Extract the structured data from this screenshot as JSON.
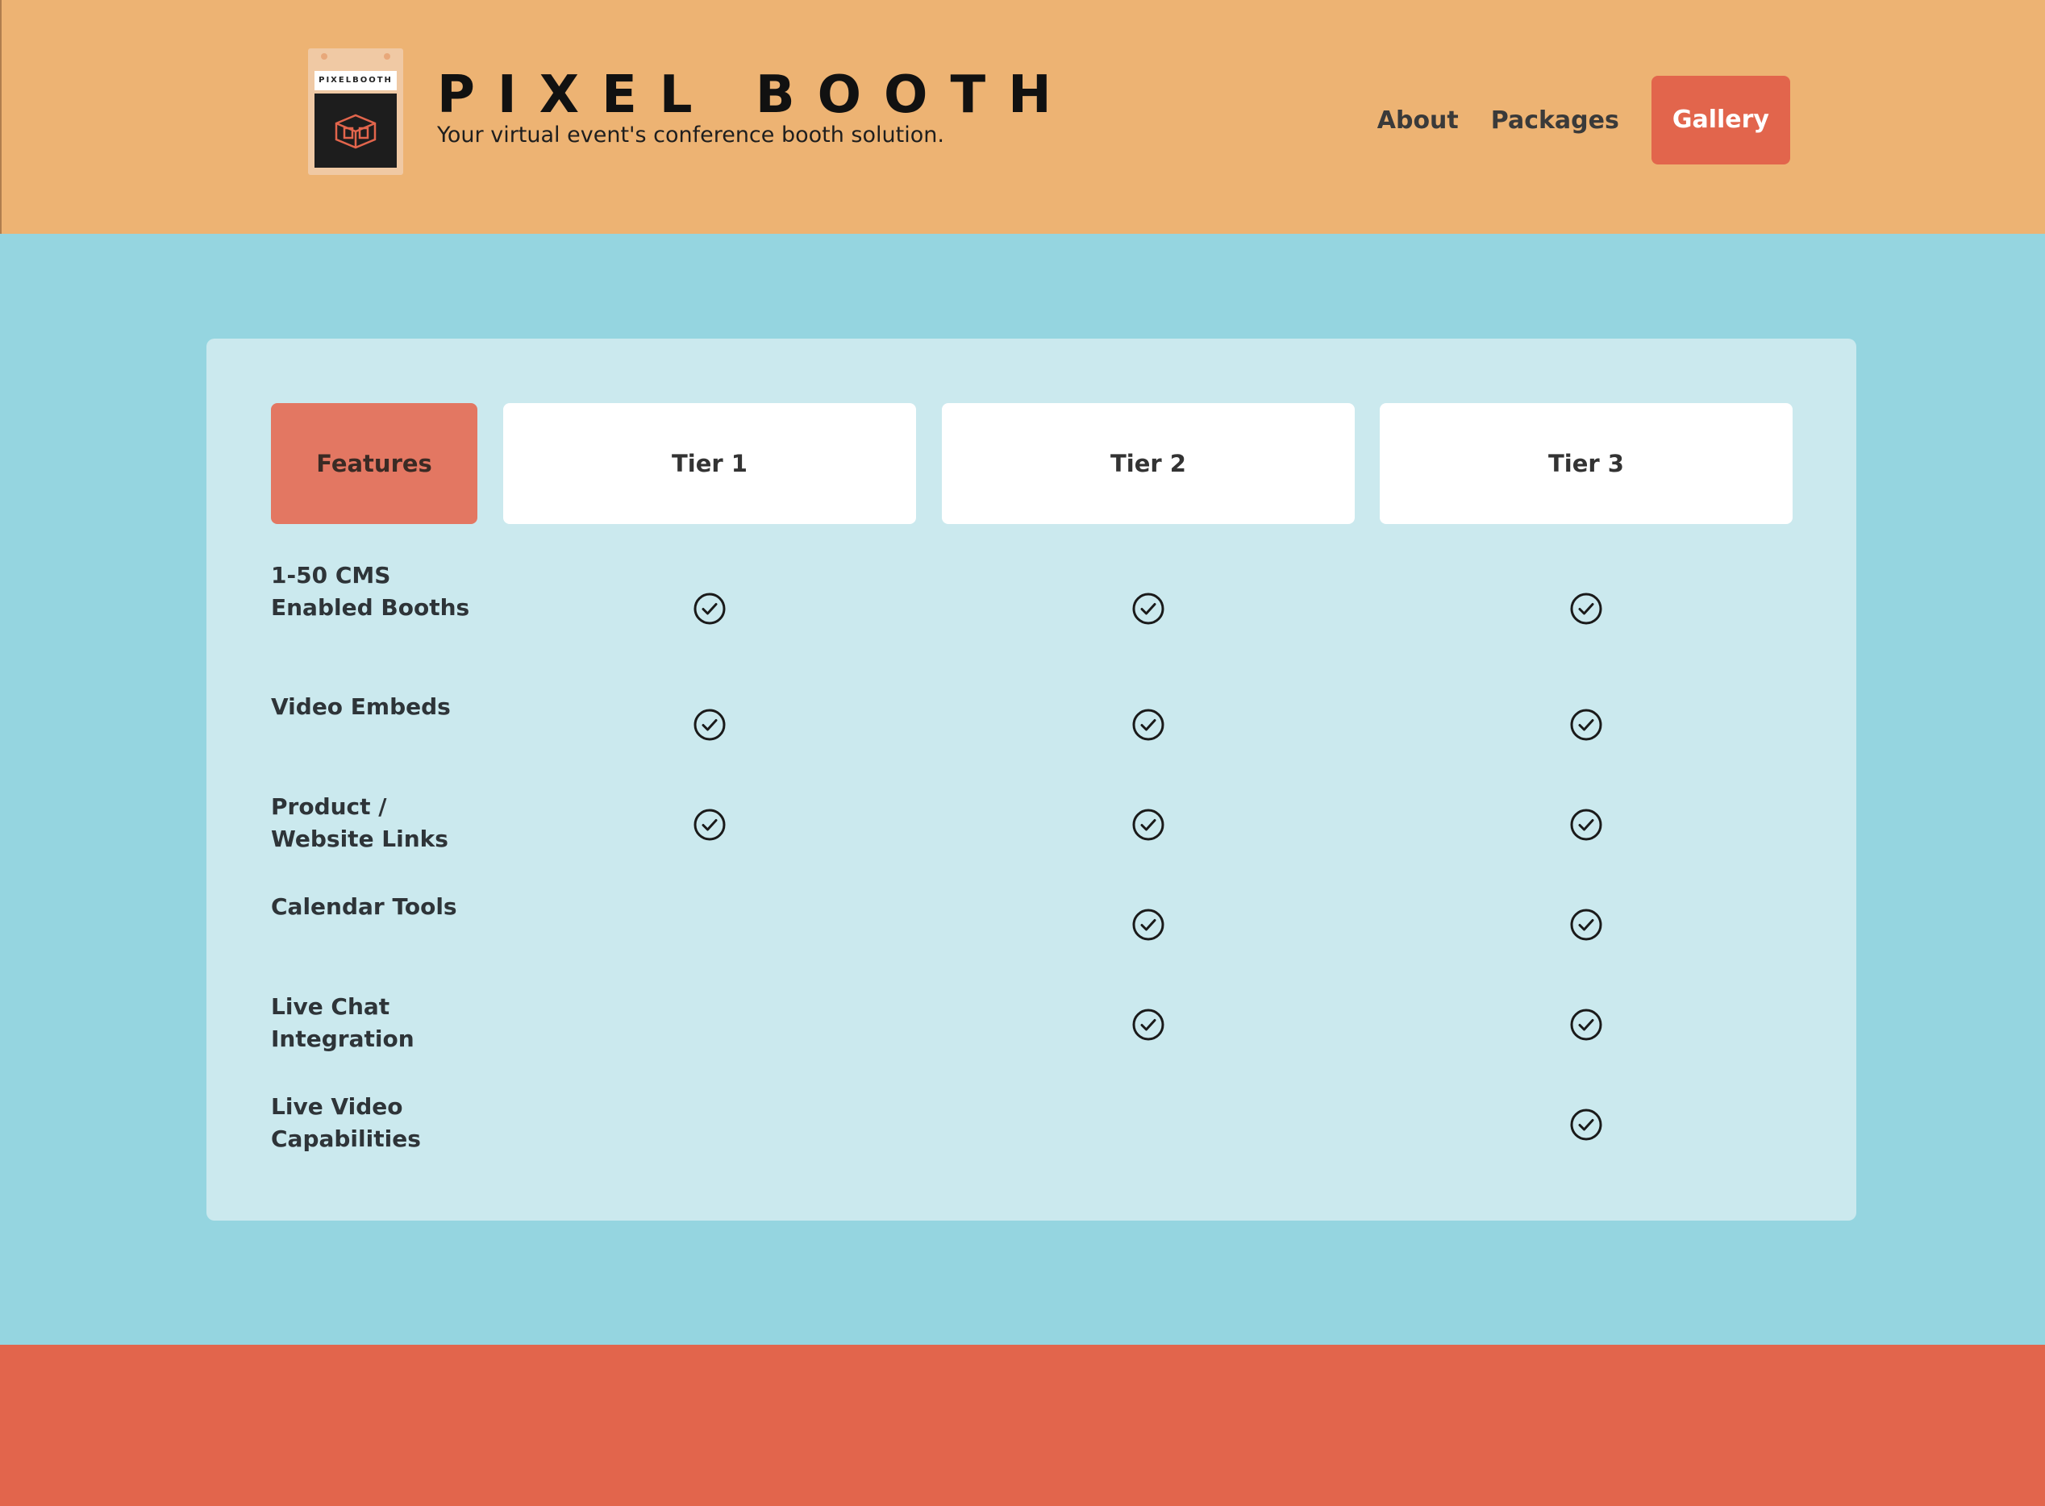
{
  "brand": {
    "logo_label": "PIXELBOOTH",
    "title": "PIXEL BOOTH",
    "tagline": "Your virtual event's conference booth solution."
  },
  "nav": {
    "about": "About",
    "packages": "Packages",
    "gallery": "Gallery"
  },
  "colors": {
    "header_bg": "#edb373",
    "page_bg": "#95d5e0",
    "card_bg": "#cbe9ee",
    "accent": "#e2654c",
    "features_header_bg": "#e37762"
  },
  "table": {
    "headers": {
      "features": "Features",
      "tier1": "Tier 1",
      "tier2": "Tier 2",
      "tier3": "Tier 3"
    },
    "rows": [
      {
        "feature": "1-50 CMS Enabled Booths",
        "tier1": true,
        "tier2": true,
        "tier3": true
      },
      {
        "feature": "Video Embeds",
        "tier1": true,
        "tier2": true,
        "tier3": true
      },
      {
        "feature": "Product / Website Links",
        "tier1": true,
        "tier2": true,
        "tier3": true
      },
      {
        "feature": "Calendar Tools",
        "tier1": false,
        "tier2": true,
        "tier3": true
      },
      {
        "feature": "Live Chat Integration",
        "tier1": false,
        "tier2": true,
        "tier3": true
      },
      {
        "feature": "Live Video Capabilities",
        "tier1": false,
        "tier2": false,
        "tier3": true
      }
    ],
    "check_icon": "check-circle-icon"
  }
}
